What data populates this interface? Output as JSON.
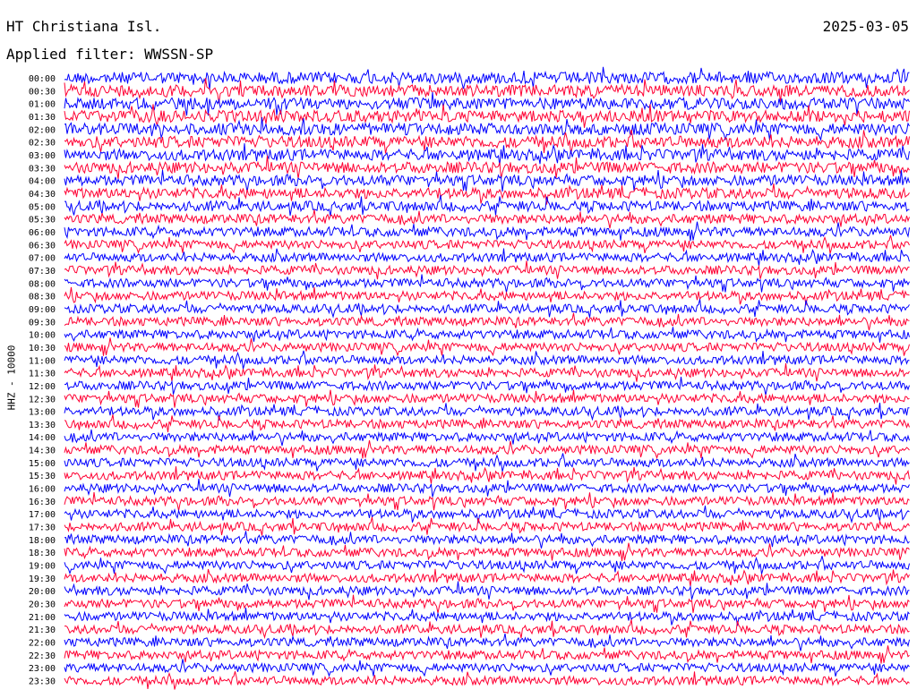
{
  "header": {
    "station": "HT Christiana Isl.",
    "date": "2025-03-05",
    "filter": "Applied filter: WWSSN-SP"
  },
  "chart_data": {
    "type": "line",
    "ylabel": "HHZ - 10000",
    "trace_colors": [
      "#0000ff",
      "#ff0033"
    ],
    "grid": false,
    "time_labels": [
      "00:00",
      "00:30",
      "01:00",
      "01:30",
      "02:00",
      "02:30",
      "03:00",
      "03:30",
      "04:00",
      "04:30",
      "05:00",
      "05:30",
      "06:00",
      "06:30",
      "07:00",
      "07:30",
      "08:00",
      "08:30",
      "09:00",
      "09:30",
      "10:00",
      "10:30",
      "11:00",
      "11:30",
      "12:00",
      "12:30",
      "13:00",
      "13:30",
      "14:00",
      "14:30",
      "15:00",
      "15:30",
      "16:00",
      "16:30",
      "17:00",
      "17:30",
      "18:00",
      "18:30",
      "19:00",
      "19:30",
      "20:00",
      "20:30",
      "21:00",
      "21:30",
      "22:00",
      "22:30",
      "23:00",
      "23:30"
    ],
    "noise_level": [
      1.0,
      1.0,
      1.0,
      1.0,
      1.0,
      1.0,
      0.95,
      0.95,
      0.9,
      0.9,
      0.85,
      0.8,
      0.8,
      0.75,
      0.75,
      0.75,
      0.75,
      0.75,
      0.75,
      0.75,
      0.75,
      0.75,
      0.75,
      0.75,
      0.75,
      0.75,
      0.75,
      0.75,
      0.75,
      0.75,
      0.75,
      0.75,
      0.75,
      0.75,
      0.75,
      0.75,
      0.75,
      0.75,
      0.75,
      0.75,
      0.75,
      0.75,
      0.75,
      0.75,
      0.75,
      0.75,
      0.75,
      0.75
    ]
  }
}
